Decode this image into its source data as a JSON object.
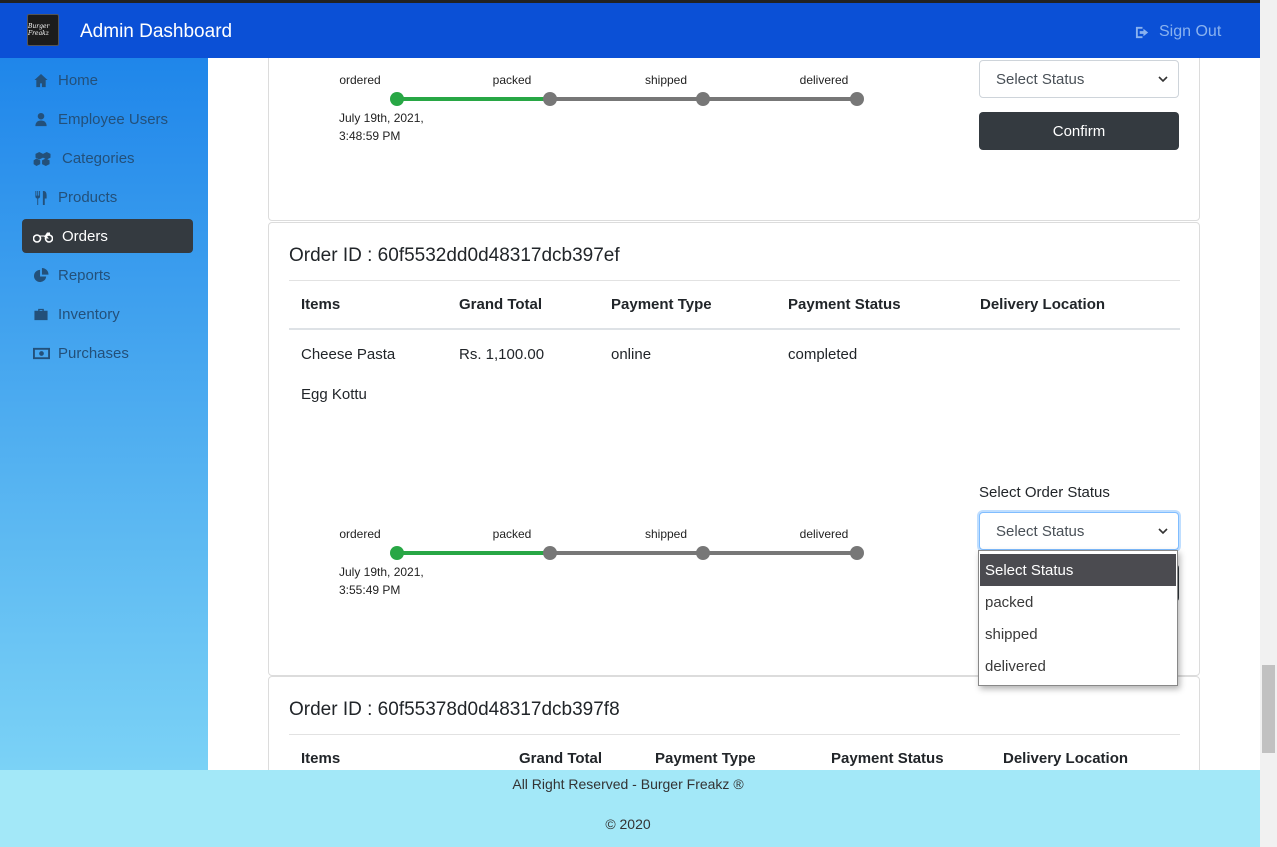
{
  "header": {
    "logo_text": "Burger Freakz",
    "title": "Admin Dashboard",
    "signout_label": "Sign Out"
  },
  "sidebar": {
    "items": [
      {
        "label": "Home",
        "icon": "home-icon",
        "active": false
      },
      {
        "label": "Employee Users",
        "icon": "user-icon",
        "active": false
      },
      {
        "label": "Categories",
        "icon": "cubes-icon",
        "active": false
      },
      {
        "label": "Products",
        "icon": "utensils-icon",
        "active": false
      },
      {
        "label": "Orders",
        "icon": "motorcycle-icon",
        "active": true
      },
      {
        "label": "Reports",
        "icon": "pie-chart-icon",
        "active": false
      },
      {
        "label": "Inventory",
        "icon": "briefcase-icon",
        "active": false
      },
      {
        "label": "Purchases",
        "icon": "money-bill-icon",
        "active": false
      }
    ]
  },
  "order_prev": {
    "steps": [
      "ordered",
      "packed",
      "shipped",
      "delivered"
    ],
    "timestamp_line1": "July 19th, 2021,",
    "timestamp_line2": "3:48:59 PM",
    "select_value": "Select Status",
    "confirm_label": "Confirm",
    "progress_step": 1
  },
  "order_current": {
    "title": "Order ID : 60f5532dd0d48317dcb397ef",
    "columns": [
      "Items",
      "Grand Total",
      "Payment Type",
      "Payment Status",
      "Delivery Location"
    ],
    "items": [
      "Cheese Pasta",
      "Egg Kottu"
    ],
    "grand_total": "Rs. 1,100.00",
    "payment_type": "online",
    "payment_status": "completed",
    "delivery_location": "",
    "status_label": "Select Order Status",
    "select_value": "Select Status",
    "steps": [
      "ordered",
      "packed",
      "shipped",
      "delivered"
    ],
    "timestamp_line1": "July 19th, 2021,",
    "timestamp_line2": "3:55:49 PM",
    "progress_step": 1
  },
  "dropdown": {
    "options": [
      "Select Status",
      "packed",
      "shipped",
      "delivered"
    ],
    "selected": "Select Status"
  },
  "order_next": {
    "title": "Order ID : 60f55378d0d48317dcb397f8",
    "columns": [
      "Items",
      "Grand Total",
      "Payment Type",
      "Payment Status",
      "Delivery Location"
    ]
  },
  "footer": {
    "line1": "All Right Reserved - Burger Freakz ®",
    "line2": "© 2020"
  },
  "colors": {
    "navbar": "#0b50d6",
    "active_nav": "#343a40",
    "progress_done": "#28a745",
    "progress_todo": "#777777"
  }
}
